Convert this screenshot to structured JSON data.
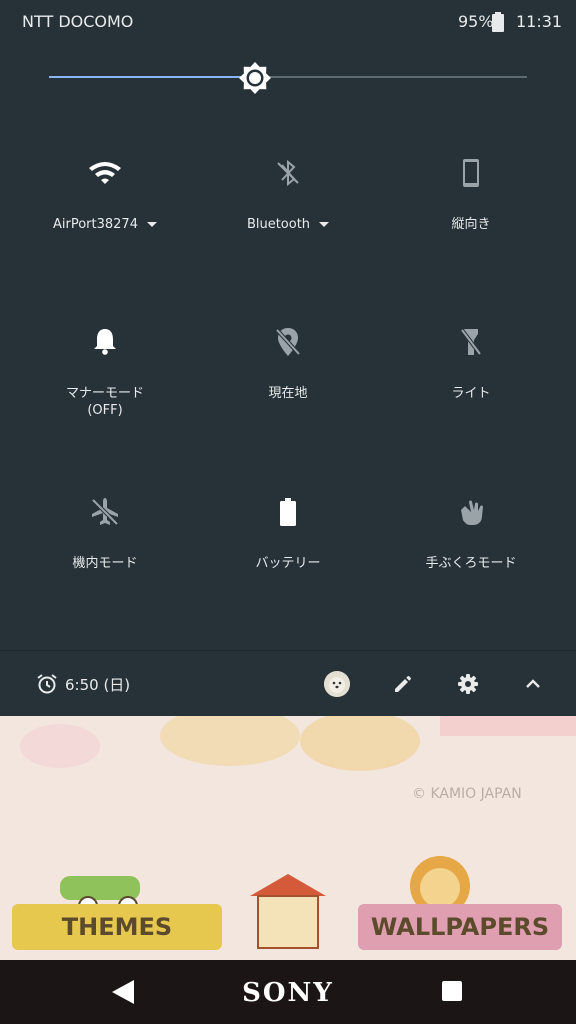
{
  "status_bar": {
    "carrier": "NTT DOCOMO",
    "battery_percent": "95%",
    "time": "11:31"
  },
  "brightness": {
    "level": 0.43
  },
  "tiles": [
    {
      "id": "wifi",
      "label": "AirPort38274",
      "icon": "wifi-icon",
      "active": true,
      "dropdown": true
    },
    {
      "id": "bluetooth",
      "label": "Bluetooth",
      "icon": "bluetooth-off-icon",
      "active": false,
      "dropdown": true
    },
    {
      "id": "rotation",
      "label": "縦向き",
      "icon": "phone-portrait-icon",
      "active": false
    },
    {
      "id": "manner",
      "label": "マナーモード\n(OFF)",
      "icon": "bell-icon",
      "active": true
    },
    {
      "id": "location",
      "label": "現在地",
      "icon": "location-off-icon",
      "active": false
    },
    {
      "id": "flashlight",
      "label": "ライト",
      "icon": "flashlight-off-icon",
      "active": false
    },
    {
      "id": "airplane",
      "label": "機内モード",
      "icon": "airplane-icon",
      "active": false
    },
    {
      "id": "battery",
      "label": "バッテリー",
      "icon": "battery-icon",
      "active": true
    },
    {
      "id": "glove",
      "label": "手ぶくろモード",
      "icon": "glove-hand-icon",
      "active": false
    }
  ],
  "footer": {
    "alarm": "6:50 (日)"
  },
  "wallpaper": {
    "copyright": "© KAMIO JAPAN",
    "left_banner": "THEMES",
    "right_banner": "WALLPAPERS"
  },
  "nav_bar": {
    "brand": "SONY"
  },
  "colors": {
    "shade_bg": "#263238",
    "accent": "#8ab4f8",
    "icon_active": "#ffffff",
    "icon_inactive": "#9aa3a8"
  }
}
